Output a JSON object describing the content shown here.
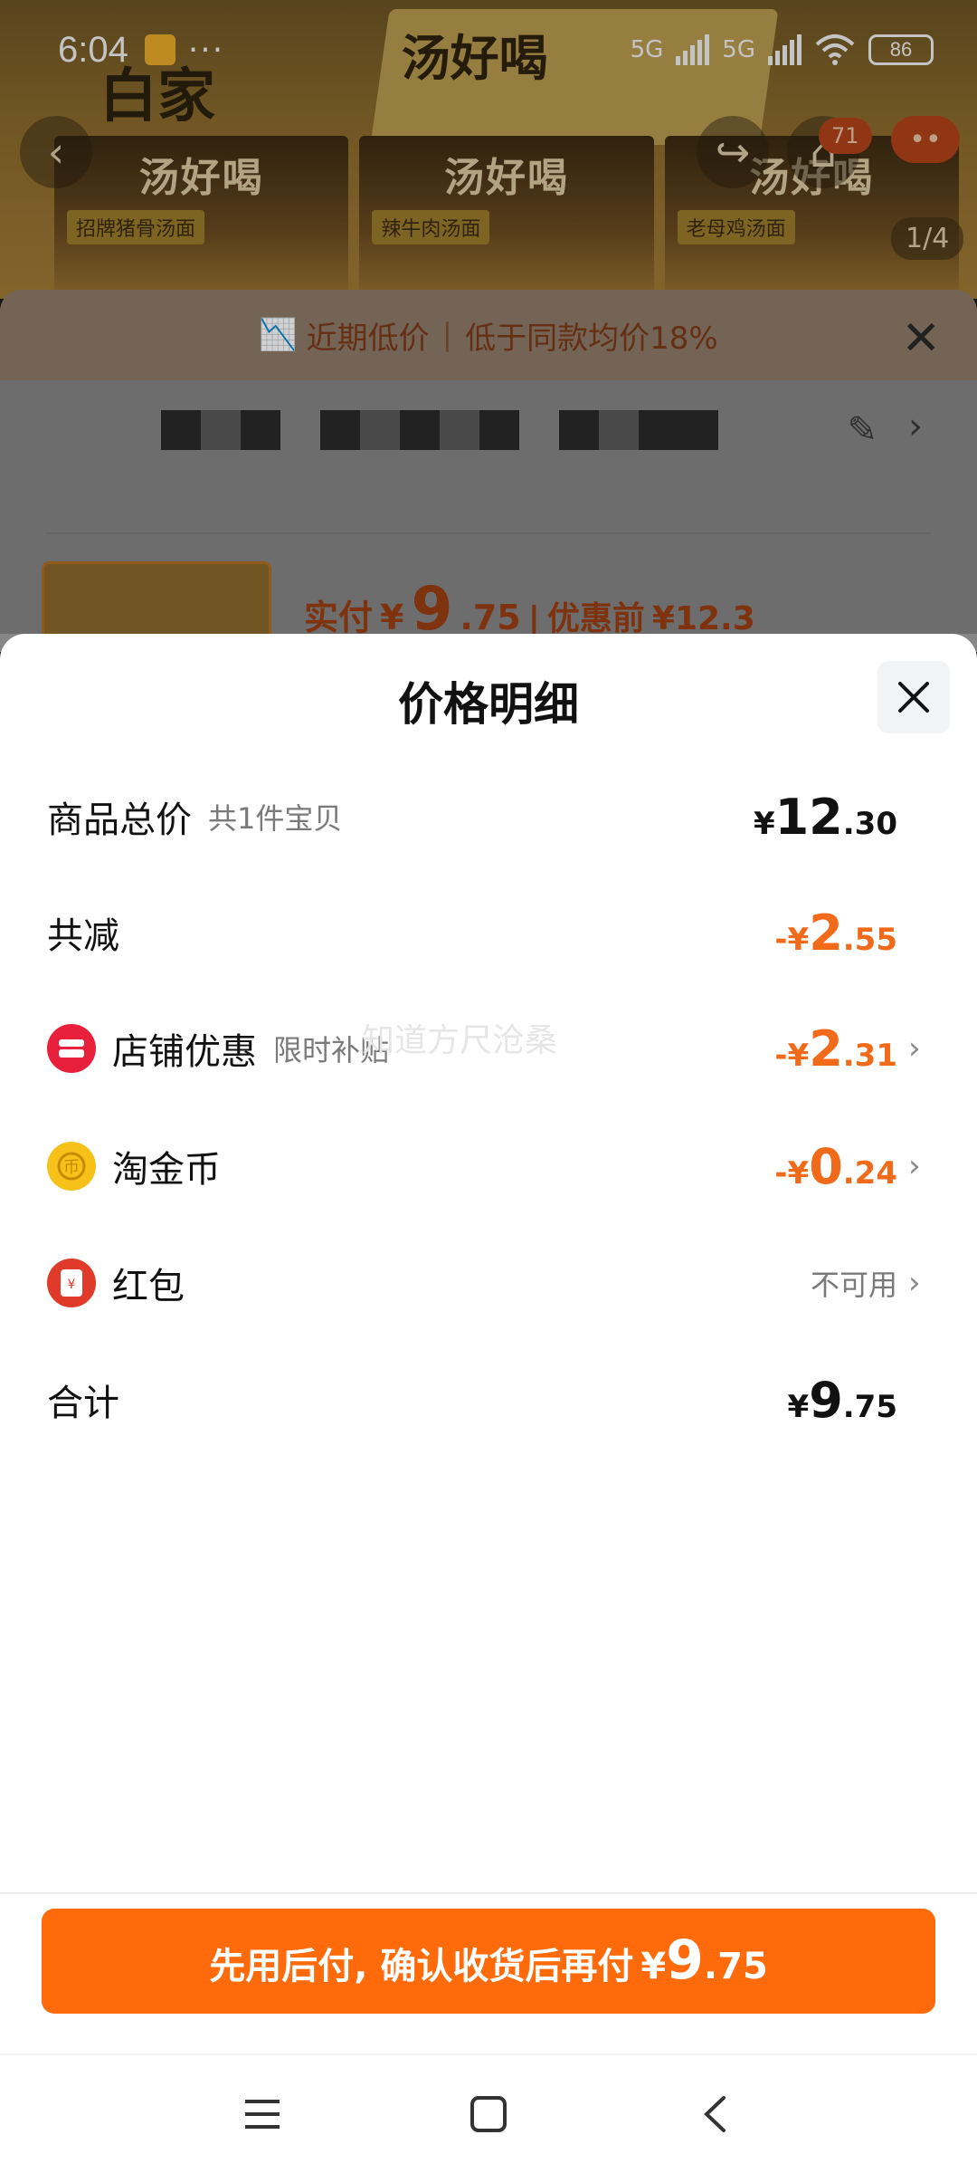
{
  "status_bar": {
    "time": "6:04",
    "more": "···",
    "network1": "5G",
    "network2": "5G",
    "battery": "86"
  },
  "background": {
    "hero_brand": "白家",
    "hero_box_text": "汤好喝",
    "packages": [
      {
        "name": "汤好喝",
        "flavor": "招牌猪骨汤面"
      },
      {
        "name": "汤好喝",
        "flavor": "辣牛肉汤面"
      },
      {
        "name": "汤好喝",
        "flavor": "老母鸡汤面"
      }
    ],
    "cart_badge": "71",
    "menu": "••",
    "page_indicator": "1/4",
    "low_price": {
      "tag": "近期低价",
      "desc": "低于同款均价18%"
    },
    "item": {
      "paid_label": "实付",
      "currency": "¥",
      "price_int": "9",
      "price_dec": ".75",
      "before_label": "优惠前",
      "before_price": "¥12.3"
    }
  },
  "sheet": {
    "title": "价格明细",
    "rows": {
      "total": {
        "label": "商品总价",
        "sub": "共1件宝贝",
        "currency": "¥",
        "int": "12",
        "dec": ".30"
      },
      "reduce": {
        "label": "共减",
        "currency": "-¥",
        "int": "2",
        "dec": ".55"
      },
      "shop": {
        "label": "店铺优惠",
        "sub": "限时补贴",
        "currency": "-¥",
        "int": "2",
        "dec": ".31"
      },
      "coin": {
        "label": "淘金币",
        "currency": "-¥",
        "int": "0",
        "dec": ".24"
      },
      "redpack": {
        "label": "红包",
        "status": "不可用"
      },
      "sum": {
        "label": "合计",
        "currency": "¥",
        "int": "9",
        "dec": ".75"
      }
    },
    "watermark": "知道方尺沧桑",
    "pay_button": {
      "text": "先用后付, 确认收货后再付",
      "currency": "¥",
      "int": "9",
      "dec": ".75"
    }
  },
  "colors": {
    "accent": "#ff6a0a",
    "discount": "#f06a1a",
    "shop_icon": "#e8203c",
    "coin_icon": "#f6c21a",
    "redpack_icon": "#e03a2a"
  }
}
